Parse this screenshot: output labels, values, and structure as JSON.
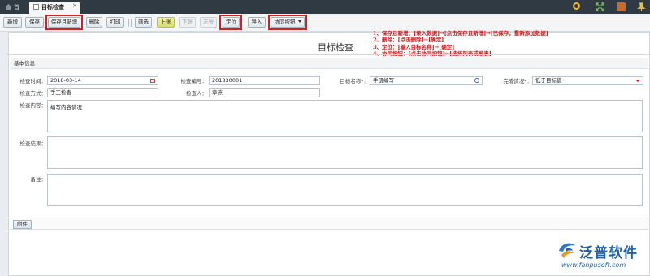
{
  "tabs": [
    {
      "label": "首页",
      "icon": "home-icon"
    },
    {
      "label": "目标检查",
      "icon": "document-icon",
      "close": "×"
    }
  ],
  "toolbar": {
    "add": "新增",
    "save": "保存",
    "save_and_new": "保存且新增",
    "delete": "删除",
    "print": "打印",
    "filter": "筛选",
    "prev": "上张",
    "next": "下张",
    "last": "末张",
    "locate": "定位",
    "import": "导入",
    "collab": "协同按钮"
  },
  "page_title": "目标检查",
  "notes": [
    "1、保存且新增：[录入数据]→[点击保存且新增]→[已保存，重新添加数据]",
    "2、删除：[点击删除]→[确定]",
    "3、定位：[输入目标名称]→[确定]",
    "4、协同按钮：[点击协同按钮]→[选择列表或报表]"
  ],
  "section": {
    "basic_info": "基本信息"
  },
  "form": {
    "check_time": {
      "label": "检查时间：",
      "value": "2018-03-14"
    },
    "check_no": {
      "label": "检查编号：",
      "value": "201830001"
    },
    "target_name": {
      "label": "目标名称*：",
      "value": "手册编写"
    },
    "completion": {
      "label": "完成情况*：",
      "value": "低于目标值"
    },
    "check_method": {
      "label": "检查方式：",
      "value": "手工检查"
    },
    "inspector": {
      "label": "检查人：",
      "value": "章燕"
    },
    "check_content": {
      "label": "检查内容：",
      "value": "编写内容情况"
    },
    "check_result": {
      "label": "检查结果：",
      "value": ""
    },
    "remarks": {
      "label": "备注：",
      "value": ""
    }
  },
  "attachment": "附件",
  "logo": {
    "name": "泛普软件",
    "url": "www.fanpusoft.com"
  },
  "colors": {
    "accent": "#1e62a8",
    "highlight": "#d42020",
    "topbar": "#2f3a43"
  }
}
